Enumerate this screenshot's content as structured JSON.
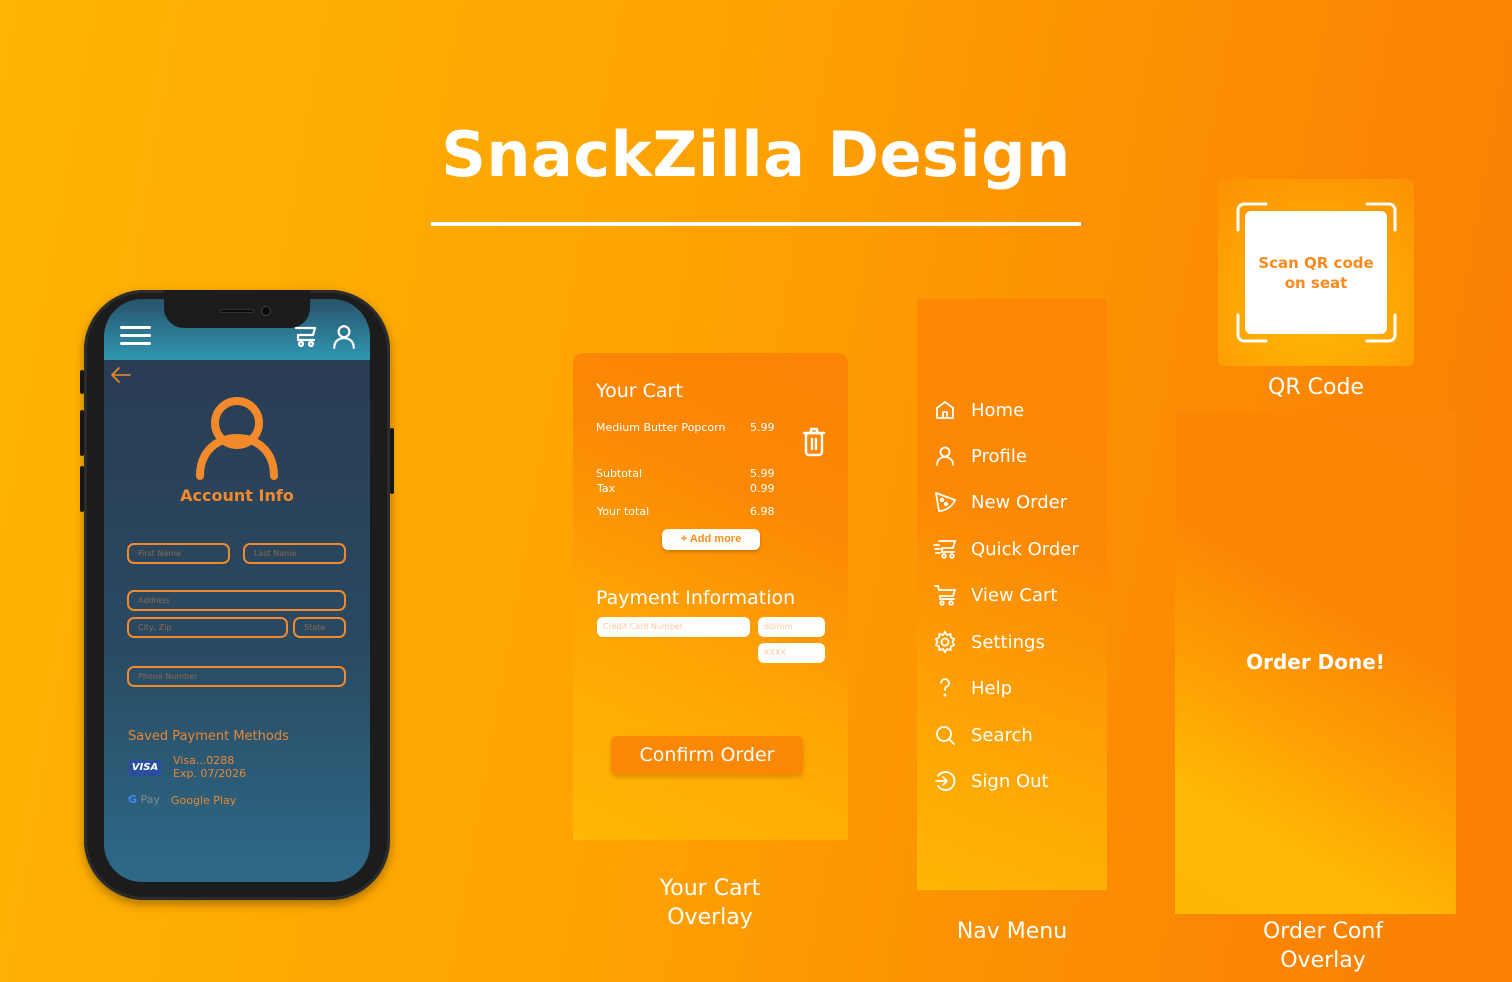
{
  "page": {
    "title": "SnackZilla Design",
    "colors": {
      "accent_orange": "#F08A2C",
      "bg_gradient_start": "#FFB504",
      "bg_gradient_end": "#FB8004",
      "phone_screen": "#2A4A62",
      "header_teal": "#3196B1"
    }
  },
  "phone": {
    "header": {
      "menu_icon": "hamburger-icon",
      "cart_icon": "cart-icon",
      "profile_icon": "user-icon"
    },
    "back_icon": "arrow-left-icon",
    "avatar_icon": "user-icon",
    "title": "Account Info",
    "fields": {
      "first_name": "First Name",
      "last_name": "Last Name",
      "address": "Address",
      "city_zip": "City, Zip",
      "state": "State",
      "phone": "Phone Number"
    },
    "saved_payments": {
      "title": "Saved Payment Methods",
      "methods": [
        {
          "badge": "VISA",
          "line1": "Visa...0288",
          "line2": "Exp. 07/2026"
        },
        {
          "badge_g": "G",
          "badge_pay": "Pay",
          "line1": "Google Play"
        }
      ]
    }
  },
  "cart": {
    "title": "Your Cart",
    "items": [
      {
        "name": "Medium Butter Popcorn",
        "price": "5.99"
      }
    ],
    "delete_icon": "trash-icon",
    "summary": [
      {
        "label": "Subtotal",
        "value": "5.99"
      },
      {
        "label": "Tax",
        "value": "0.99"
      },
      {
        "label": "Your total",
        "value": "6.98"
      }
    ],
    "add_more": "+ Add more",
    "payment": {
      "title": "Payment Information",
      "card_placeholder": "Credit Card Number",
      "exp_placeholder": "dd/mm",
      "cvv_placeholder": "XXXX"
    },
    "confirm": "Confirm Order",
    "caption_line1": "Your Cart",
    "caption_line2": "Overlay"
  },
  "nav_menu": {
    "items": [
      {
        "label": "Home",
        "icon": "home-icon"
      },
      {
        "label": "Profile",
        "icon": "user-icon"
      },
      {
        "label": "New Order",
        "icon": "pizza-slice-icon"
      },
      {
        "label": "Quick Order",
        "icon": "fast-cart-icon"
      },
      {
        "label": "View Cart",
        "icon": "cart-icon"
      },
      {
        "label": "Settings",
        "icon": "gear-icon"
      },
      {
        "label": "Help",
        "icon": "question-icon"
      },
      {
        "label": "Search",
        "icon": "search-icon"
      },
      {
        "label": "Sign Out",
        "icon": "sign-out-icon"
      }
    ],
    "caption": "Nav Menu"
  },
  "qr": {
    "prompt_line1": "Scan QR code",
    "prompt_line2": "on seat",
    "caption": "QR Code"
  },
  "order_conf": {
    "message": "Order Done!",
    "caption_line1": "Order Conf",
    "caption_line2": "Overlay"
  }
}
